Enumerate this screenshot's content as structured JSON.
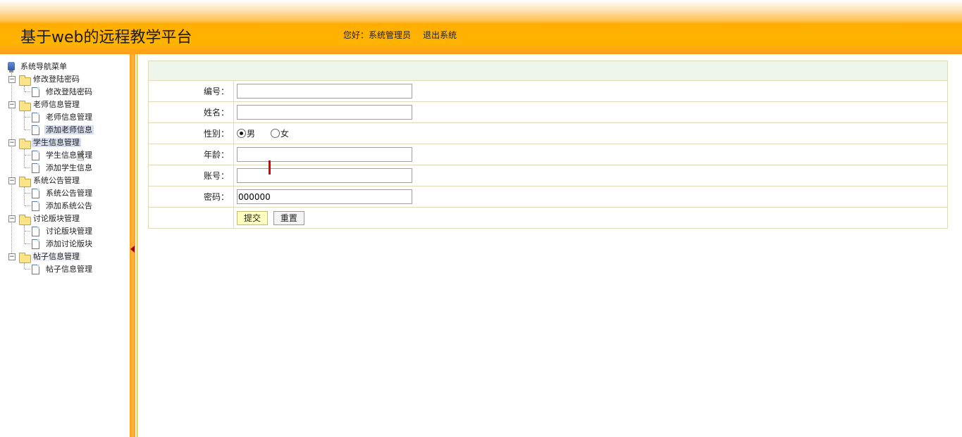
{
  "header": {
    "title": "基于web的远程教学平台",
    "greeting": "您好：系统管理员",
    "logout_label": "退出系统"
  },
  "sidebar": {
    "root_label": "系统导航菜单",
    "groups": [
      {
        "label": "修改登陆密码",
        "items": [
          {
            "label": "修改登陆密码"
          }
        ]
      },
      {
        "label": "老师信息管理",
        "items": [
          {
            "label": "老师信息管理"
          },
          {
            "label": "添加老师信息",
            "selected": true
          }
        ]
      },
      {
        "label": "学生信息管理",
        "items": [
          {
            "label": "学生信息管理"
          },
          {
            "label": "添加学生信息"
          }
        ]
      },
      {
        "label": "系统公告管理",
        "items": [
          {
            "label": "系统公告管理"
          },
          {
            "label": "添加系统公告"
          }
        ]
      },
      {
        "label": "讨论版块管理",
        "items": [
          {
            "label": "讨论版块管理"
          },
          {
            "label": "添加讨论版块"
          }
        ]
      },
      {
        "label": "帖子信息管理",
        "items": [
          {
            "label": "帖子信息管理"
          }
        ]
      }
    ]
  },
  "form": {
    "fields": {
      "id_label": "编号：",
      "id_value": "",
      "name_label": "姓名：",
      "name_value": "",
      "gender_label": "性别：",
      "gender_options": [
        "男",
        "女"
      ],
      "gender_selected": "男",
      "age_label": "年龄：",
      "age_value": "",
      "account_label": "账号：",
      "account_value": "",
      "password_label": "密码：",
      "password_value": "000000"
    },
    "submit_label": "提交",
    "reset_label": "重置"
  },
  "colors": {
    "header_orange": "#ffb400",
    "table_border": "#dcdcb8",
    "table_head_bg": "#eef5ea",
    "selected_item_bg": "#d6def0"
  }
}
